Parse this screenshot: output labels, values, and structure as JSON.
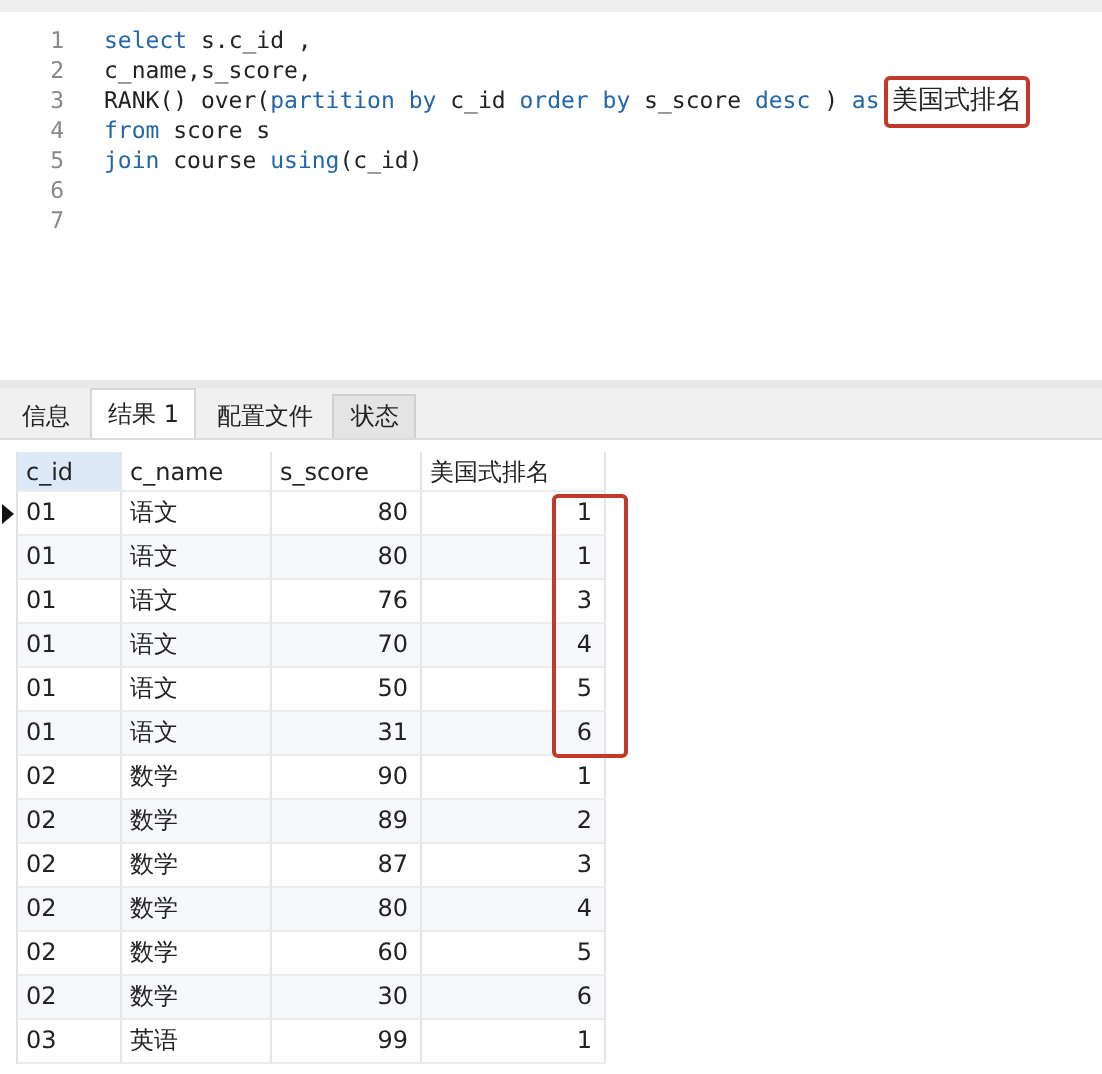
{
  "editor": {
    "lines": [
      {
        "number": "1",
        "tokens": [
          {
            "kind": "keyword",
            "text": "select"
          },
          {
            "kind": "plain",
            "text": " s.c_id ,"
          }
        ]
      },
      {
        "number": "2",
        "tokens": [
          {
            "kind": "plain",
            "text": "c_name,s_score,"
          }
        ]
      },
      {
        "number": "3",
        "tokens": [
          {
            "kind": "plain",
            "text": "RANK() over("
          },
          {
            "kind": "keyword",
            "text": "partition by"
          },
          {
            "kind": "plain",
            "text": " c_id "
          },
          {
            "kind": "keyword",
            "text": "order by"
          },
          {
            "kind": "plain",
            "text": " s_score "
          },
          {
            "kind": "keyword",
            "text": "desc"
          },
          {
            "kind": "plain",
            "text": " ) "
          },
          {
            "kind": "keyword",
            "text": "as"
          },
          {
            "kind": "boxed",
            "text": "美国式排名"
          }
        ]
      },
      {
        "number": "4",
        "tokens": [
          {
            "kind": "keyword",
            "text": "from"
          },
          {
            "kind": "plain",
            "text": " score s"
          }
        ]
      },
      {
        "number": "5",
        "tokens": [
          {
            "kind": "keyword",
            "text": "join"
          },
          {
            "kind": "plain",
            "text": " course "
          },
          {
            "kind": "keyword",
            "text": "using"
          },
          {
            "kind": "plain",
            "text": "(c_id)"
          }
        ]
      },
      {
        "number": "6"
      },
      {
        "number": "7"
      }
    ]
  },
  "tabs": [
    {
      "label": "信息",
      "selected": false
    },
    {
      "label": "结果 1",
      "selected": true
    },
    {
      "label": "配置文件",
      "selected": false
    },
    {
      "label": "状态",
      "selected": false
    }
  ],
  "table": {
    "columns": [
      {
        "label": "c_id",
        "selected": true
      },
      {
        "label": "c_name",
        "selected": false
      },
      {
        "label": "s_score",
        "selected": false
      },
      {
        "label": "美国式排名",
        "selected": false
      }
    ],
    "rows": [
      {
        "cells": [
          "01",
          "语文",
          "80",
          "1"
        ],
        "selected": true,
        "highlighted": true
      },
      {
        "cells": [
          "01",
          "语文",
          "80",
          "1"
        ],
        "selected": false,
        "highlighted": true
      },
      {
        "cells": [
          "01",
          "语文",
          "76",
          "3"
        ],
        "selected": false,
        "highlighted": true
      },
      {
        "cells": [
          "01",
          "语文",
          "70",
          "4"
        ],
        "selected": false,
        "highlighted": true
      },
      {
        "cells": [
          "01",
          "语文",
          "50",
          "5"
        ],
        "selected": false,
        "highlighted": true
      },
      {
        "cells": [
          "01",
          "语文",
          "31",
          "6"
        ],
        "selected": false,
        "highlighted": true
      },
      {
        "cells": [
          "02",
          "数学",
          "90",
          "1"
        ],
        "selected": false,
        "highlighted": false
      },
      {
        "cells": [
          "02",
          "数学",
          "89",
          "2"
        ],
        "selected": false,
        "highlighted": false
      },
      {
        "cells": [
          "02",
          "数学",
          "87",
          "3"
        ],
        "selected": false,
        "highlighted": false
      },
      {
        "cells": [
          "02",
          "数学",
          "80",
          "4"
        ],
        "selected": false,
        "highlighted": false
      },
      {
        "cells": [
          "02",
          "数学",
          "60",
          "5"
        ],
        "selected": false,
        "highlighted": false
      },
      {
        "cells": [
          "02",
          "数学",
          "30",
          "6"
        ],
        "selected": false,
        "highlighted": false
      },
      {
        "cells": [
          "03",
          "英语",
          "99",
          "1"
        ],
        "selected": false,
        "highlighted": false
      }
    ]
  }
}
